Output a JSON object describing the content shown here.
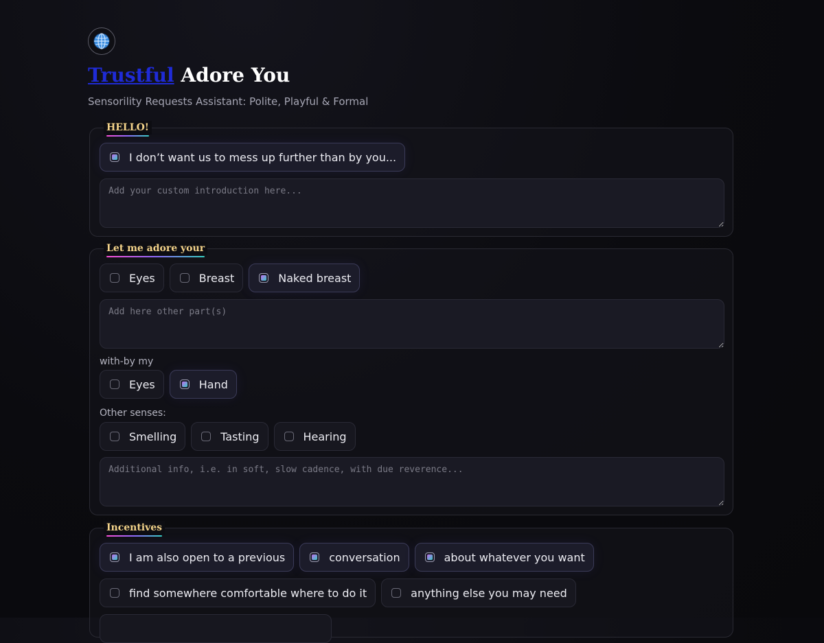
{
  "header": {
    "title_link": "Trustful",
    "title_rest": " Adore You",
    "subtitle": "Sensorility Requests Assistant: Polite, Playful & Formal"
  },
  "hello": {
    "legend": "HELLO!",
    "options": [
      {
        "label": "I don’t want us to mess up further than by you...",
        "checked": true
      }
    ],
    "placeholder": "Add your custom introduction here..."
  },
  "adore": {
    "legend": "Let me adore your",
    "parts": [
      {
        "label": "Eyes",
        "checked": false
      },
      {
        "label": "Breast",
        "checked": false
      },
      {
        "label": "Naked breast",
        "checked": true
      }
    ],
    "parts_placeholder": "Add here other part(s)",
    "with_label": "with-by my",
    "with": [
      {
        "label": "Eyes",
        "checked": false
      },
      {
        "label": "Hand",
        "checked": true
      }
    ],
    "senses_label": "Other senses:",
    "senses": [
      {
        "label": "Smelling",
        "checked": false
      },
      {
        "label": "Tasting",
        "checked": false
      },
      {
        "label": "Hearing",
        "checked": false
      }
    ],
    "info_placeholder": "Additional info, i.e. in soft, slow cadence, with due reverence..."
  },
  "incentives": {
    "legend": "Incentives",
    "row1": [
      {
        "label": "I am also open to a previous",
        "checked": true
      },
      {
        "label": "conversation",
        "checked": true
      },
      {
        "label": "about whatever you want",
        "checked": true
      }
    ],
    "row2": [
      {
        "label": "find somewhere comfortable where to do it",
        "checked": false
      },
      {
        "label": "anything else you may need",
        "checked": false
      }
    ]
  },
  "colors": {
    "accent_gradient": [
      "#c56cf0",
      "#36c9c4"
    ],
    "legend_color": "#f3d38a",
    "link_color": "#1f2bd6"
  },
  "icons": {
    "logo": "globe-icon"
  }
}
